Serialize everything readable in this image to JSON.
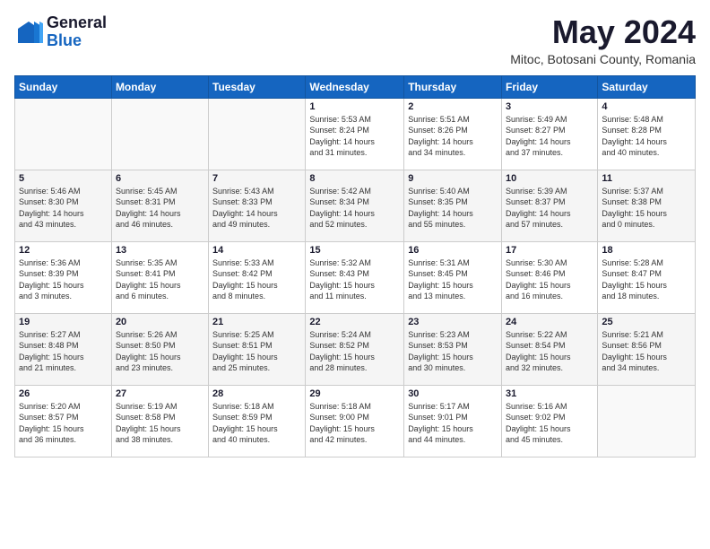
{
  "logo": {
    "general": "General",
    "blue": "Blue"
  },
  "title": {
    "month": "May 2024",
    "location": "Mitoc, Botosani County, Romania"
  },
  "days_of_week": [
    "Sunday",
    "Monday",
    "Tuesday",
    "Wednesday",
    "Thursday",
    "Friday",
    "Saturday"
  ],
  "weeks": [
    [
      {
        "day": "",
        "info": ""
      },
      {
        "day": "",
        "info": ""
      },
      {
        "day": "",
        "info": ""
      },
      {
        "day": "1",
        "info": "Sunrise: 5:53 AM\nSunset: 8:24 PM\nDaylight: 14 hours\nand 31 minutes."
      },
      {
        "day": "2",
        "info": "Sunrise: 5:51 AM\nSunset: 8:26 PM\nDaylight: 14 hours\nand 34 minutes."
      },
      {
        "day": "3",
        "info": "Sunrise: 5:49 AM\nSunset: 8:27 PM\nDaylight: 14 hours\nand 37 minutes."
      },
      {
        "day": "4",
        "info": "Sunrise: 5:48 AM\nSunset: 8:28 PM\nDaylight: 14 hours\nand 40 minutes."
      }
    ],
    [
      {
        "day": "5",
        "info": "Sunrise: 5:46 AM\nSunset: 8:30 PM\nDaylight: 14 hours\nand 43 minutes."
      },
      {
        "day": "6",
        "info": "Sunrise: 5:45 AM\nSunset: 8:31 PM\nDaylight: 14 hours\nand 46 minutes."
      },
      {
        "day": "7",
        "info": "Sunrise: 5:43 AM\nSunset: 8:33 PM\nDaylight: 14 hours\nand 49 minutes."
      },
      {
        "day": "8",
        "info": "Sunrise: 5:42 AM\nSunset: 8:34 PM\nDaylight: 14 hours\nand 52 minutes."
      },
      {
        "day": "9",
        "info": "Sunrise: 5:40 AM\nSunset: 8:35 PM\nDaylight: 14 hours\nand 55 minutes."
      },
      {
        "day": "10",
        "info": "Sunrise: 5:39 AM\nSunset: 8:37 PM\nDaylight: 14 hours\nand 57 minutes."
      },
      {
        "day": "11",
        "info": "Sunrise: 5:37 AM\nSunset: 8:38 PM\nDaylight: 15 hours\nand 0 minutes."
      }
    ],
    [
      {
        "day": "12",
        "info": "Sunrise: 5:36 AM\nSunset: 8:39 PM\nDaylight: 15 hours\nand 3 minutes."
      },
      {
        "day": "13",
        "info": "Sunrise: 5:35 AM\nSunset: 8:41 PM\nDaylight: 15 hours\nand 6 minutes."
      },
      {
        "day": "14",
        "info": "Sunrise: 5:33 AM\nSunset: 8:42 PM\nDaylight: 15 hours\nand 8 minutes."
      },
      {
        "day": "15",
        "info": "Sunrise: 5:32 AM\nSunset: 8:43 PM\nDaylight: 15 hours\nand 11 minutes."
      },
      {
        "day": "16",
        "info": "Sunrise: 5:31 AM\nSunset: 8:45 PM\nDaylight: 15 hours\nand 13 minutes."
      },
      {
        "day": "17",
        "info": "Sunrise: 5:30 AM\nSunset: 8:46 PM\nDaylight: 15 hours\nand 16 minutes."
      },
      {
        "day": "18",
        "info": "Sunrise: 5:28 AM\nSunset: 8:47 PM\nDaylight: 15 hours\nand 18 minutes."
      }
    ],
    [
      {
        "day": "19",
        "info": "Sunrise: 5:27 AM\nSunset: 8:48 PM\nDaylight: 15 hours\nand 21 minutes."
      },
      {
        "day": "20",
        "info": "Sunrise: 5:26 AM\nSunset: 8:50 PM\nDaylight: 15 hours\nand 23 minutes."
      },
      {
        "day": "21",
        "info": "Sunrise: 5:25 AM\nSunset: 8:51 PM\nDaylight: 15 hours\nand 25 minutes."
      },
      {
        "day": "22",
        "info": "Sunrise: 5:24 AM\nSunset: 8:52 PM\nDaylight: 15 hours\nand 28 minutes."
      },
      {
        "day": "23",
        "info": "Sunrise: 5:23 AM\nSunset: 8:53 PM\nDaylight: 15 hours\nand 30 minutes."
      },
      {
        "day": "24",
        "info": "Sunrise: 5:22 AM\nSunset: 8:54 PM\nDaylight: 15 hours\nand 32 minutes."
      },
      {
        "day": "25",
        "info": "Sunrise: 5:21 AM\nSunset: 8:56 PM\nDaylight: 15 hours\nand 34 minutes."
      }
    ],
    [
      {
        "day": "26",
        "info": "Sunrise: 5:20 AM\nSunset: 8:57 PM\nDaylight: 15 hours\nand 36 minutes."
      },
      {
        "day": "27",
        "info": "Sunrise: 5:19 AM\nSunset: 8:58 PM\nDaylight: 15 hours\nand 38 minutes."
      },
      {
        "day": "28",
        "info": "Sunrise: 5:18 AM\nSunset: 8:59 PM\nDaylight: 15 hours\nand 40 minutes."
      },
      {
        "day": "29",
        "info": "Sunrise: 5:18 AM\nSunset: 9:00 PM\nDaylight: 15 hours\nand 42 minutes."
      },
      {
        "day": "30",
        "info": "Sunrise: 5:17 AM\nSunset: 9:01 PM\nDaylight: 15 hours\nand 44 minutes."
      },
      {
        "day": "31",
        "info": "Sunrise: 5:16 AM\nSunset: 9:02 PM\nDaylight: 15 hours\nand 45 minutes."
      },
      {
        "day": "",
        "info": ""
      }
    ]
  ]
}
